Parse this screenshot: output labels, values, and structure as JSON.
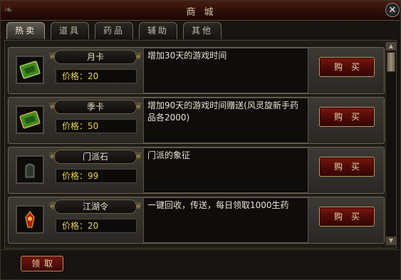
{
  "window": {
    "title": "商 城",
    "close_label": "✕"
  },
  "tabs": [
    {
      "label": "热卖",
      "active": true
    },
    {
      "label": "道具",
      "active": false
    },
    {
      "label": "药品",
      "active": false
    },
    {
      "label": "辅助",
      "active": false
    },
    {
      "label": "其他",
      "active": false
    }
  ],
  "items": [
    {
      "name": "月卡",
      "price_label": "价格：",
      "price": "20",
      "desc": "增加30天的游戏时间",
      "buy_label": "购买",
      "icon": "month-card-icon"
    },
    {
      "name": "季卡",
      "price_label": "价格：",
      "price": "50",
      "desc": "增加90天的游戏时间赠送(风灵旋新手药品各2000)",
      "buy_label": "购买",
      "icon": "season-card-icon"
    },
    {
      "name": "门派石",
      "price_label": "价格：",
      "price": "99",
      "desc": "门派的象征",
      "buy_label": "购买",
      "icon": "sect-stone-icon"
    },
    {
      "name": "江湖令",
      "price_label": "价格：",
      "price": "20",
      "desc": "一键回收，传送，每日领取1000生药",
      "buy_label": "购买",
      "icon": "jianghu-token-icon"
    }
  ],
  "footer": {
    "claim_label": "领取"
  },
  "colors": {
    "price": "#e9d44a",
    "buy_bg": "#6a130d",
    "card_green": "#4fa62a"
  }
}
